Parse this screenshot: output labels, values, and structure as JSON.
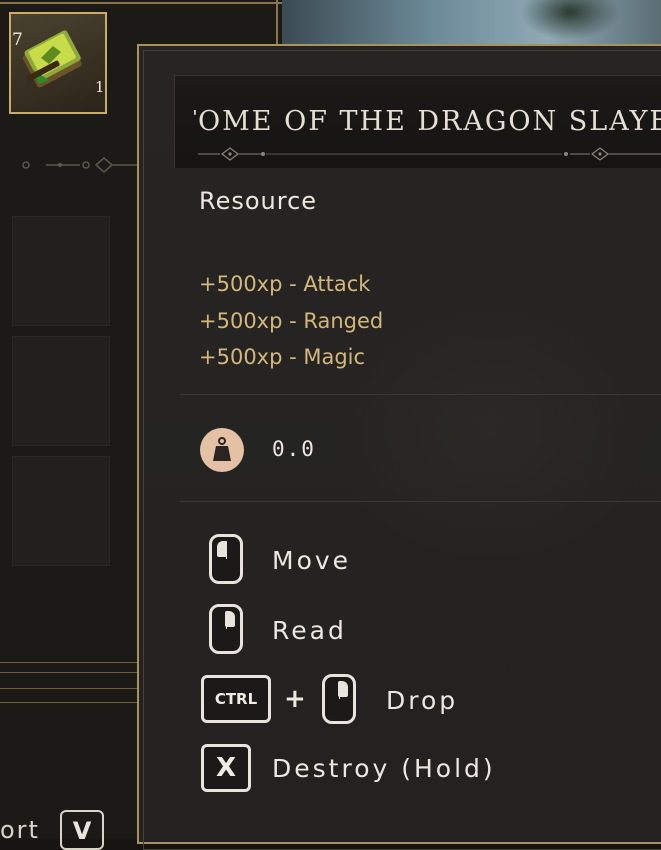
{
  "inventory": {
    "slot": {
      "tier": "7",
      "quantity": "1",
      "icon": "green-book-icon"
    },
    "bottom_hint": {
      "label": "ort",
      "key": "V"
    }
  },
  "tooltip": {
    "title": "TOME OF THE DRAGON SLAYER",
    "category": "Resource",
    "stats": [
      "+500xp - Attack",
      "+500xp - Ranged",
      "+500xp - Magic"
    ],
    "weight": "0.0",
    "weight_icon": "weight-icon",
    "actions": [
      {
        "input": "left-mouse",
        "label": "Move"
      },
      {
        "input": "right-mouse",
        "label": "Read"
      },
      {
        "modifier": "CTRL",
        "plus": "+",
        "input": "right-mouse",
        "label": "Drop"
      },
      {
        "key": "X",
        "label": "Destroy (Hold)"
      }
    ]
  },
  "colors": {
    "accent_gold": "#c8ac68",
    "stat_text": "#d4b77a",
    "text": "#ece8e0"
  }
}
